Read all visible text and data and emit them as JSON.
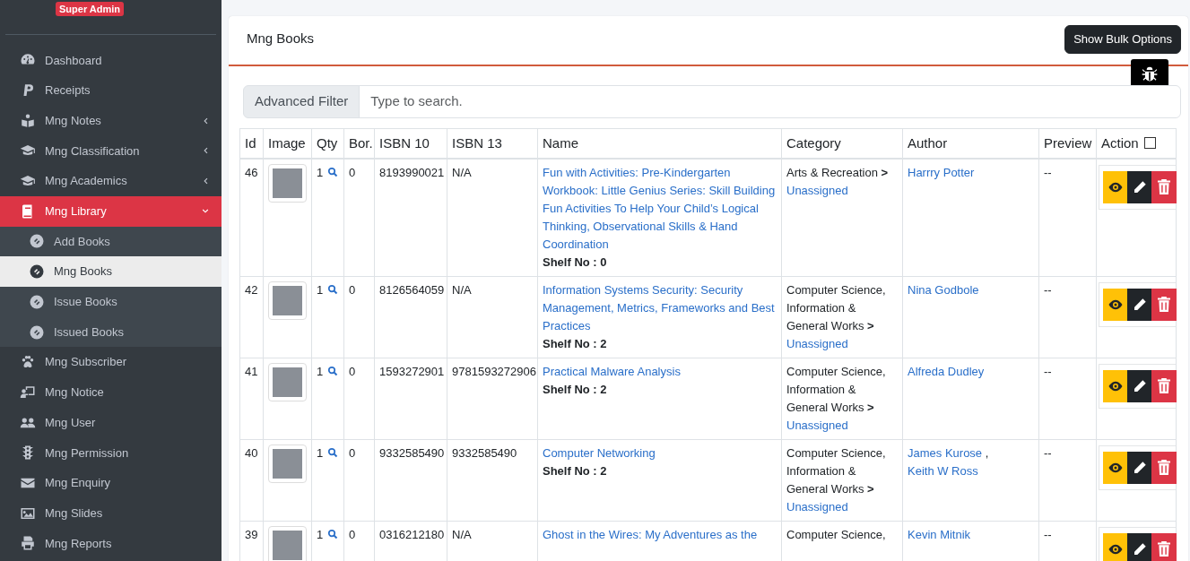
{
  "sidebar": {
    "badge": "Super Admin",
    "items": [
      {
        "label": "Dashboard",
        "selected": false
      },
      {
        "label": "Receipts",
        "selected": false
      },
      {
        "label": "Mng Notes",
        "selected": false,
        "expanded": false
      },
      {
        "label": "Mng Classification",
        "selected": false,
        "expanded": false
      },
      {
        "label": "Mng Academics",
        "selected": false,
        "expanded": false
      },
      {
        "label": "Mng Library",
        "selected": false,
        "expanded": true,
        "children": [
          {
            "label": "Add Books",
            "selected": false
          },
          {
            "label": "Mng Books",
            "selected": true
          },
          {
            "label": "Issue Books",
            "selected": false
          },
          {
            "label": "Issued Books",
            "selected": false
          }
        ]
      },
      {
        "label": "Mng Subscriber",
        "selected": false
      },
      {
        "label": "Mng Notice",
        "selected": false
      },
      {
        "label": "Mng User",
        "selected": false
      },
      {
        "label": "Mng Permission",
        "selected": false
      },
      {
        "label": "Mng Enquiry",
        "selected": false
      },
      {
        "label": "Mng Slides",
        "selected": false
      },
      {
        "label": "Mng Reports",
        "selected": false
      }
    ]
  },
  "card": {
    "title": "Mng Books",
    "bulk_button": "Show Bulk Options",
    "filter": {
      "label": "Advanced Filter",
      "placeholder": "Type to search."
    },
    "table": {
      "columns": [
        "Id",
        "Image",
        "Qty",
        "Bor.",
        "ISBN 10",
        "ISBN 13",
        "Name",
        "Category",
        "Author",
        "Preview",
        "Action"
      ],
      "select_all": {
        "checked": false
      },
      "rows": [
        {
          "id": "46",
          "qty": "1",
          "borrowed": "0",
          "isbn10": "8193990021",
          "isbn13": "N/A",
          "name": "Fun with Activities: Pre-Kindergarten Workbook: Little Genius Series: Skill Building Fun Activities To Help Your Child’s Logical Thinking, Observational Skills & Hand Coordination",
          "shelf": "Shelf No : 0",
          "category": "Arts & Recreation **>**",
          "subcategory": "Unassigned",
          "authors": [
            "Harrry Potter"
          ],
          "preview": "--"
        },
        {
          "id": "42",
          "qty": "1",
          "borrowed": "0",
          "isbn10": "8126564059",
          "isbn13": "N/A",
          "name": "Information Systems Security: Security Management, Metrics, Frameworks and Best Practices",
          "shelf": "Shelf No : 2",
          "category": "Computer Science, Information & General Works **>**",
          "subcategory": "Unassigned",
          "authors": [
            "Nina Godbole"
          ],
          "preview": "--"
        },
        {
          "id": "41",
          "qty": "1",
          "borrowed": "0",
          "isbn10": "1593272901",
          "isbn13": "9781593272906",
          "name": "Practical Malware Analysis",
          "shelf": "Shelf No : 2",
          "category": "Computer Science, Information & General Works **>**",
          "subcategory": "Unassigned",
          "authors": [
            "Alfreda Dudley"
          ],
          "preview": "--"
        },
        {
          "id": "40",
          "qty": "1",
          "borrowed": "0",
          "isbn10": "9332585490",
          "isbn13": "9332585490",
          "name": "Computer Networking",
          "shelf": "Shelf No : 2",
          "category": "Computer Science, Information & General Works **>**",
          "subcategory": "Unassigned",
          "authors": [
            "James Kurose",
            "Keith W Ross"
          ],
          "author_separator": ",",
          "preview": "--"
        },
        {
          "id": "39",
          "qty": "1",
          "borrowed": "0",
          "isbn10": "0316212180",
          "isbn13": "N/A",
          "name": "Ghost in the Wires: My Adventures as the",
          "category": "Computer Science,",
          "authors": [
            "Kevin Mitnik"
          ],
          "preview": "--"
        }
      ]
    }
  }
}
